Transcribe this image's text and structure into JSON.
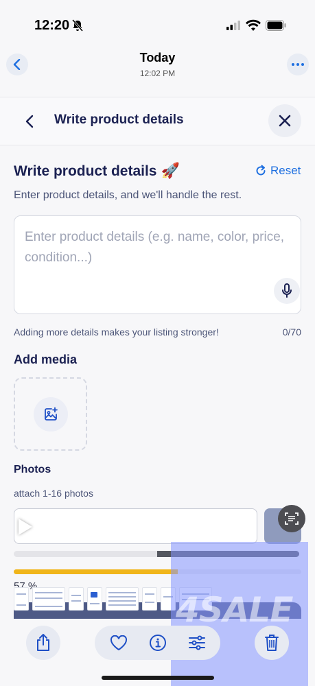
{
  "status_bar": {
    "time": "12:20"
  },
  "viewer_header": {
    "title": "Today",
    "subtitle": "12:02 PM"
  },
  "app_header": {
    "title": "Write product details"
  },
  "form": {
    "heading": "Write product details",
    "heading_emoji": "🚀",
    "reset_label": "Reset",
    "description": "Enter product details, and we'll handle the rest.",
    "details_placeholder": "Enter product details (e.g. name, color, price, condition...)",
    "details_value": "",
    "hint": "Adding more details makes your listing stronger!",
    "char_count": "0/70",
    "media_heading": "Add media",
    "photos_heading": "Photos",
    "photos_hint": "attach 1-16 photos"
  },
  "overlay": {
    "progress_label": "57 %",
    "progress_value": 0.57,
    "brand_watermark": "4SALE"
  },
  "icons": {
    "viewer_back": "chevron-left-icon",
    "viewer_more": "more-icon",
    "back": "chevron-left-icon",
    "close": "close-icon",
    "reset": "refresh-icon",
    "mic": "microphone-icon",
    "add_photo": "add-photo-icon",
    "share": "share-icon",
    "favorite": "heart-icon",
    "info": "info-icon",
    "adjust": "sliders-icon",
    "delete": "trash-icon"
  },
  "colors": {
    "primary_text": "#1b2152",
    "accent": "#1e6fe0",
    "progress": "#f0b51a",
    "overlay": "#8596ff"
  }
}
